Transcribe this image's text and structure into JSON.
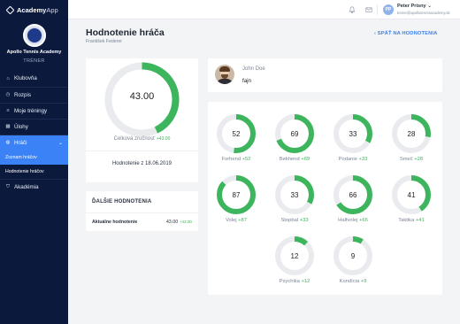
{
  "app": {
    "brand_bold": "Academy",
    "brand_light": "App"
  },
  "club": {
    "name": "Apollo Tennis Academy",
    "role": "TRÉNER"
  },
  "sidebar": {
    "items": [
      {
        "label": "Klubovňa",
        "icon": "home-icon"
      },
      {
        "label": "Rozpis",
        "icon": "clock-icon"
      },
      {
        "label": "Moje tréningy",
        "icon": "list-icon"
      },
      {
        "label": "Úlohy",
        "icon": "calendar-icon"
      },
      {
        "label": "Hráči",
        "icon": "globe-icon",
        "active": true
      },
      {
        "label": "Akadémia",
        "icon": "shield-icon"
      }
    ],
    "sub_items": [
      {
        "label": "Zoznam hráčov"
      },
      {
        "label": "Hodnotenie hráčov"
      }
    ]
  },
  "topbar": {
    "avatar_initials": "PP",
    "user_name": "Peter Prisny",
    "user_email": "trener@apollotennisacademy.sk"
  },
  "page": {
    "title": "Hodnotenie hráča",
    "subtitle": "František Federer",
    "back_label": "SPÄŤ NA HODNOTENIA"
  },
  "overall": {
    "value": "43.00",
    "percent": 43,
    "label": "Celková zručnosť",
    "delta": "+43.00",
    "date_label": "Hodnotenie z 18.06.2019"
  },
  "others": {
    "heading": "ĎALŠIE HODNOTENIA",
    "rows": [
      {
        "label": "Aktuálne hodnotenie",
        "value": "43.00",
        "delta": "+43.00"
      }
    ]
  },
  "comment": {
    "author": "John Doe",
    "text": "fajn"
  },
  "skills": [
    {
      "name": "Forhend",
      "value": 52,
      "delta": "+52"
    },
    {
      "name": "Bekhend",
      "value": 69,
      "delta": "+69"
    },
    {
      "name": "Podanie",
      "value": 33,
      "delta": "+33"
    },
    {
      "name": "Smeč",
      "value": 28,
      "delta": "+28"
    },
    {
      "name": "Volej",
      "value": 87,
      "delta": "+87"
    },
    {
      "name": "Stopbal",
      "value": 33,
      "delta": "+33"
    },
    {
      "name": "Halfvolej",
      "value": 66,
      "delta": "+66"
    },
    {
      "name": "Taktika",
      "value": 41,
      "delta": "+41"
    },
    {
      "name": "Psychika",
      "value": 12,
      "delta": "+12"
    },
    {
      "name": "Kondícia",
      "value": 9,
      "delta": "+9"
    }
  ],
  "colors": {
    "accent": "#3b82f6",
    "progress": "#3cb55d",
    "track": "#e9ebee",
    "sidebar": "#0b1a3c"
  }
}
